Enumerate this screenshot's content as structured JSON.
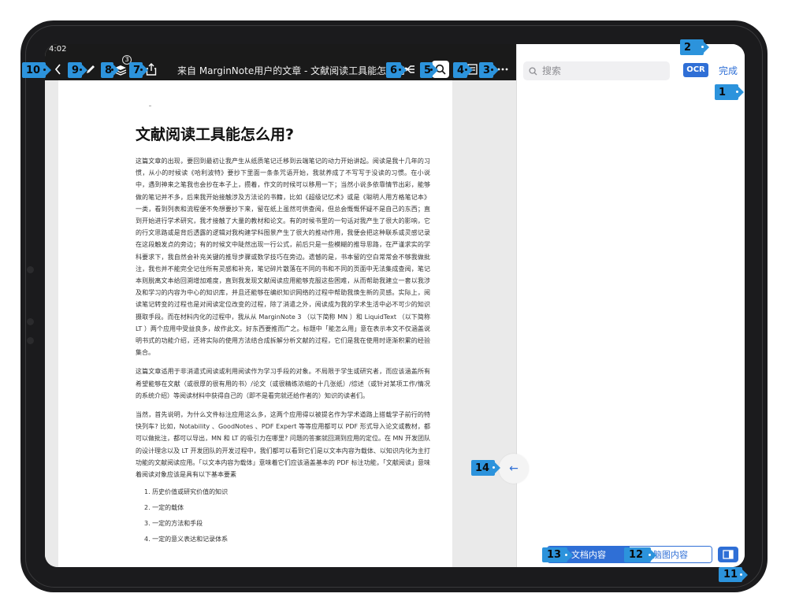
{
  "status": {
    "time": "4:02"
  },
  "toolbar": {
    "title": "来自 MarginNote用户的文章 - 文献阅读工具能怎么用",
    "icons": [
      "back-icon",
      "pen-icon",
      "layers-icon",
      "share-icon",
      "mindmap-icon",
      "search-icon",
      "outline-icon",
      "more-icon"
    ],
    "layer_badge": "3"
  },
  "document": {
    "heading": "文献阅读工具能怎么用?",
    "paragraphs": [
      "这篇文章的出现，要回到最初让我产生从纸质笔记迁移到云端笔记的动力开始讲起。阅读是我十几年的习惯，从小的时候读《哈利波特》要抄下里面一条条咒语开始，我就养成了不写写于没读的习惯。在小说中，遇到神来之笔我也会抄在本子上，攒着，作文的时候可以移用一下；当然小说多依靠情节出彩，能够做的笔记并不多，后来我开始接触涉及方法论的书籍，比如《超级记忆术》或是《聪明人用方格笔记本》一类，看到列表和流程便不免想要抄下来，留在纸上虽然可供查阅，但总会慨慨怀疑不是自己的东西；直到开始进行学术研究，我才接触了大量的教材和论文。有的时候书里的一句话对我产生了很大的影响，它的行文思路或是背后透露的逻辑对我构建学科图景产生了很大的推动作用，我便会把这种联系或灵感记录在这段触发点的旁边；有的时候文中陡然出现一行公式，前后只是一些模糊的推导思路，在严谨求实的学科要求下，我自然会补充关键的推导步骤或数学技巧在旁边。遗憾的是，书本留的空白常常会不够我做批注，我也并不能完全记住所有灵感和补充，笔记碎片散落在不同的书和不同的页面中无法集成查阅，笔记本则脱离文本给回溯增加难度，直到我发现文献阅读应用能够克服这些困难，从而帮助我建立一套以我涉及和学习的内容为中心的知识库，并且还能够在编织知识网络的过程中帮助我焕生新的灵感。实际上，阅读笔记转变的过程也是对阅读定位改变的过程，除了消遣之外，阅读成为我的学术生活中必不可少的知识摄取手段。而在材料内化的过程中，我从从 MarginNote 3 （以下简称 MN ）和 LiquidText （以下简称 LT ）两个应用中受益良多，故作此文。好东西要推而广之。标题中「能怎么用」意在表示本文不仅涵盖说明书式的功能介绍，还将实际的使用方法结合成拆解分析文献的过程，它们是我在使用时逐渐积累的经验集合。",
      "这篇文章适用于非消遣式阅读或利用阅读作为学习手段的对象。不局限于学生或研究者，而应该涵盖所有希望能够在文献（或很厚的很有用的书）/论文（或很精练浓缩的十几张纸）/综述（或针对某项工作/情况的系统介绍）等阅读材料中获得自己的（即不是看完就还给作者的）知识的读者们。",
      "当然，首先说明，为什么文件标注应用这么多，这两个应用得以被提名作为学术道路上搭载学子前行的特快列车? 比如，Notability 、GoodNotes 、PDF Expert 等等应用都可以 PDF 形式导入论文或教材，都可以做批注，都可以导出，MN 和 LT 的吸引力在哪里? 问题的答案就回溯到应用的定位。在 MN 开发团队的设计理念以及 LT 开发团队的开发过程中，我们都可以看到它们是以文本内容为载体、以知识内化为主打功能的文献阅读应用。「以文本内容为载体」意味着它们应该涵盖基本的 PDF 标注功能，「文献阅读」意味着阅读对象应该是具有以下基本要素"
    ],
    "list_items": [
      "1.  历史价值或研究价值的知识",
      "2.  一定的载体",
      "3.  一定的方法和手段",
      "4.  一定的意义表达和记录体系"
    ]
  },
  "panel": {
    "search_placeholder": "搜索",
    "ocr_label": "OCR",
    "done_label": "完成",
    "tab_doc": "文档内容",
    "tab_mindmap": "脑图内容"
  },
  "callouts": [
    "1",
    "2",
    "3",
    "4",
    "5",
    "6",
    "7",
    "8",
    "9",
    "10",
    "11",
    "12",
    "13",
    "14"
  ],
  "colors": {
    "accent": "#2f6fd6",
    "callout": "#2c93dc",
    "toolbar_bg": "#1a1a1a"
  }
}
